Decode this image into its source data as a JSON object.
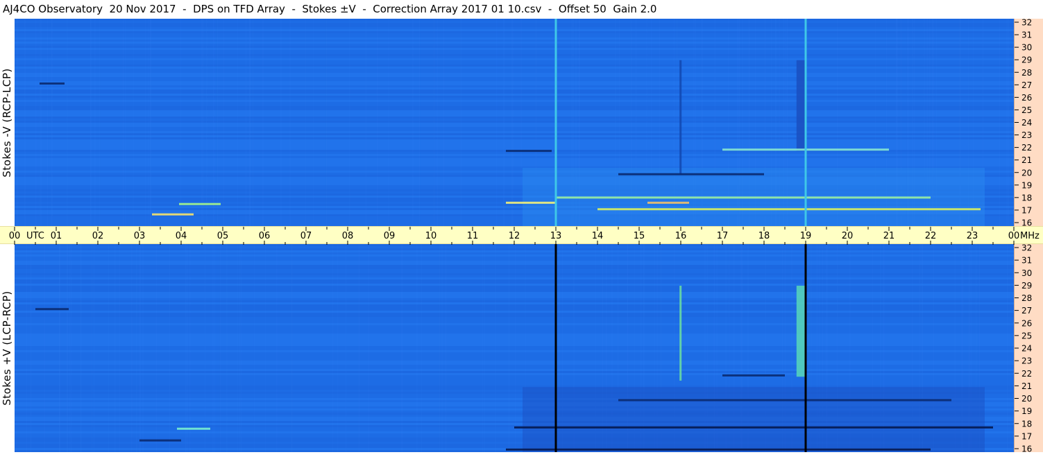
{
  "title": "AJ4CO Observatory  20 Nov 2017  -  DPS on TFD Array  -  Stokes ±V  -  Correction Array 2017 01 10.csv  -  Offset 50  Gain 2.0",
  "chart_data": [
    {
      "type": "heatmap",
      "panel": "top",
      "ylabel": "Stokes -V (RCP-LCP)",
      "x": {
        "utc_ticks": [
          "00",
          "01",
          "02",
          "03",
          "04",
          "05",
          "06",
          "07",
          "08",
          "09",
          "10",
          "11",
          "12",
          "13",
          "14",
          "15",
          "16",
          "17",
          "18",
          "19",
          "20",
          "21",
          "22",
          "23",
          "00"
        ],
        "range_hours": [
          0,
          24
        ],
        "unit_label": "UTC"
      },
      "y": {
        "mhz_ticks": [
          16,
          17,
          18,
          19,
          20,
          21,
          22,
          23,
          24,
          25,
          26,
          27,
          28,
          29,
          30,
          31,
          32
        ],
        "range_mhz": [
          16,
          32
        ],
        "unit_label": "MHz"
      },
      "features": [
        {
          "kind": "vertical_line",
          "utc": 13.0,
          "color": "#3fc8e8"
        },
        {
          "kind": "vertical_line",
          "utc": 19.0,
          "color": "#3fc8e8"
        },
        {
          "kind": "vertical_band",
          "utc_start": 15.97,
          "utc_end": 16.02,
          "mhz_start": 20.0,
          "mhz_end": 28.8,
          "color": "#1248b0"
        },
        {
          "kind": "vertical_band",
          "utc_start": 18.78,
          "utc_end": 18.98,
          "mhz_start": 21.8,
          "mhz_end": 28.8,
          "color": "#1a4fc0"
        },
        {
          "kind": "horizontal_streak",
          "utc_start": 0.6,
          "utc_end": 1.2,
          "mhz": 27.0,
          "color": "#0a2a70"
        },
        {
          "kind": "horizontal_streak",
          "utc_start": 3.95,
          "utc_end": 4.95,
          "mhz": 17.7,
          "color": "#a6f58a"
        },
        {
          "kind": "horizontal_streak",
          "utc_start": 3.3,
          "utc_end": 4.3,
          "mhz": 16.9,
          "color": "#f7e46a"
        },
        {
          "kind": "horizontal_streak",
          "utc_start": 11.8,
          "utc_end": 13.0,
          "mhz": 17.8,
          "color": "#f2f07a"
        },
        {
          "kind": "horizontal_streak",
          "utc_start": 15.2,
          "utc_end": 16.2,
          "mhz": 17.8,
          "color": "#f0c06a"
        },
        {
          "kind": "horizontal_streak",
          "utc_start": 14.0,
          "utc_end": 23.2,
          "mhz": 17.3,
          "color": "#d8f060"
        },
        {
          "kind": "horizontal_streak",
          "utc_start": 13.0,
          "utc_end": 22.0,
          "mhz": 18.2,
          "color": "#9af0a0"
        },
        {
          "kind": "horizontal_streak",
          "utc_start": 17.0,
          "utc_end": 21.0,
          "mhz": 21.9,
          "color": "#88e8d0"
        },
        {
          "kind": "horizontal_streak",
          "utc_start": 14.5,
          "utc_end": 18.0,
          "mhz": 20.0,
          "color": "#0a2a70"
        },
        {
          "kind": "horizontal_streak",
          "utc_start": 11.8,
          "utc_end": 12.9,
          "mhz": 21.8,
          "color": "#0a2a70"
        },
        {
          "kind": "region",
          "utc_start": 12.2,
          "utc_end": 23.3,
          "mhz_start": 16.0,
          "mhz_end": 20.5,
          "color": "#2a8af0"
        }
      ]
    },
    {
      "type": "heatmap",
      "panel": "bottom",
      "ylabel": "Stokes +V (LCP-RCP)",
      "x": {
        "utc_ticks": [
          "00",
          "01",
          "02",
          "03",
          "04",
          "05",
          "06",
          "07",
          "08",
          "09",
          "10",
          "11",
          "12",
          "13",
          "14",
          "15",
          "16",
          "17",
          "18",
          "19",
          "20",
          "21",
          "22",
          "23",
          "00"
        ],
        "range_hours": [
          0,
          24
        ],
        "unit_label": "UTC"
      },
      "y": {
        "mhz_ticks": [
          16,
          17,
          18,
          19,
          20,
          21,
          22,
          23,
          24,
          25,
          26,
          27,
          28,
          29,
          30,
          31,
          32
        ],
        "range_mhz": [
          16,
          32
        ],
        "unit_label": "MHz"
      },
      "features": [
        {
          "kind": "vertical_line",
          "utc": 13.0,
          "color": "#000000"
        },
        {
          "kind": "vertical_line",
          "utc": 19.0,
          "color": "#000000"
        },
        {
          "kind": "vertical_band",
          "utc_start": 15.97,
          "utc_end": 16.02,
          "mhz_start": 21.5,
          "mhz_end": 28.8,
          "color": "#6ce0a0"
        },
        {
          "kind": "vertical_band",
          "utc_start": 18.78,
          "utc_end": 18.98,
          "mhz_start": 21.8,
          "mhz_end": 28.8,
          "color": "#58d8b8"
        },
        {
          "kind": "horizontal_streak",
          "utc_start": 0.5,
          "utc_end": 1.3,
          "mhz": 27.0,
          "color": "#0a2a70"
        },
        {
          "kind": "horizontal_streak",
          "utc_start": 3.9,
          "utc_end": 4.7,
          "mhz": 17.8,
          "color": "#7af0d0"
        },
        {
          "kind": "horizontal_streak",
          "utc_start": 3.0,
          "utc_end": 4.0,
          "mhz": 16.9,
          "color": "#0a2a70"
        },
        {
          "kind": "horizontal_streak",
          "utc_start": 12.0,
          "utc_end": 23.5,
          "mhz": 17.9,
          "color": "#061a50"
        },
        {
          "kind": "horizontal_streak",
          "utc_start": 11.8,
          "utc_end": 22.0,
          "mhz": 16.2,
          "color": "#061a50"
        },
        {
          "kind": "horizontal_streak",
          "utc_start": 14.5,
          "utc_end": 22.5,
          "mhz": 20.0,
          "color": "#0a2a70"
        },
        {
          "kind": "horizontal_streak",
          "utc_start": 17.0,
          "utc_end": 18.5,
          "mhz": 21.9,
          "color": "#0a2a70"
        },
        {
          "kind": "region",
          "utc_start": 12.2,
          "utc_end": 23.3,
          "mhz_start": 16.0,
          "mhz_end": 21.0,
          "color": "#1a4ec0"
        }
      ]
    }
  ],
  "colors": {
    "background_blue": "#1f6fe6",
    "utc_bar": "#ffffc4",
    "mhz_bar": "#ffdcc4"
  }
}
